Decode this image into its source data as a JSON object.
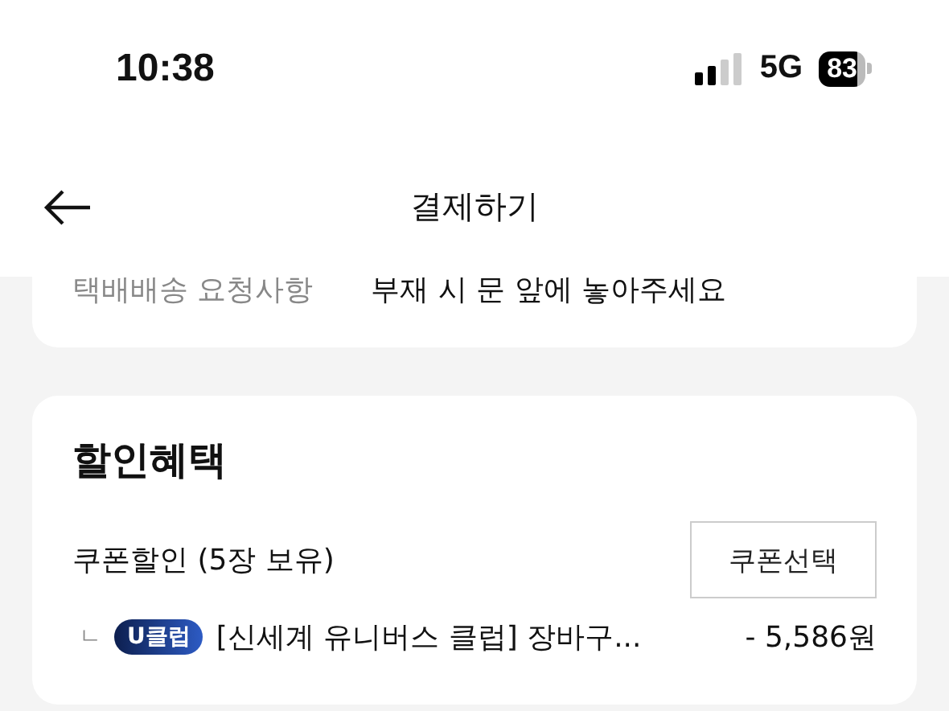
{
  "status_bar": {
    "time": "10:38",
    "network": "5G",
    "battery": "83"
  },
  "header": {
    "title": "결제하기"
  },
  "delivery_card": {
    "label": "택배배송 요청사항",
    "value": "부재 시 문 앞에 놓아주세요"
  },
  "discount_card": {
    "title": "할인혜택",
    "coupon": {
      "label": "쿠폰할인 (5장 보유)",
      "button": "쿠폰선택"
    },
    "items": [
      {
        "marker": "ㄴ",
        "badge": "U클럽",
        "name": "[신세계 유니버스 클럽] 장바구...",
        "amount": "- 5,586원"
      }
    ]
  }
}
